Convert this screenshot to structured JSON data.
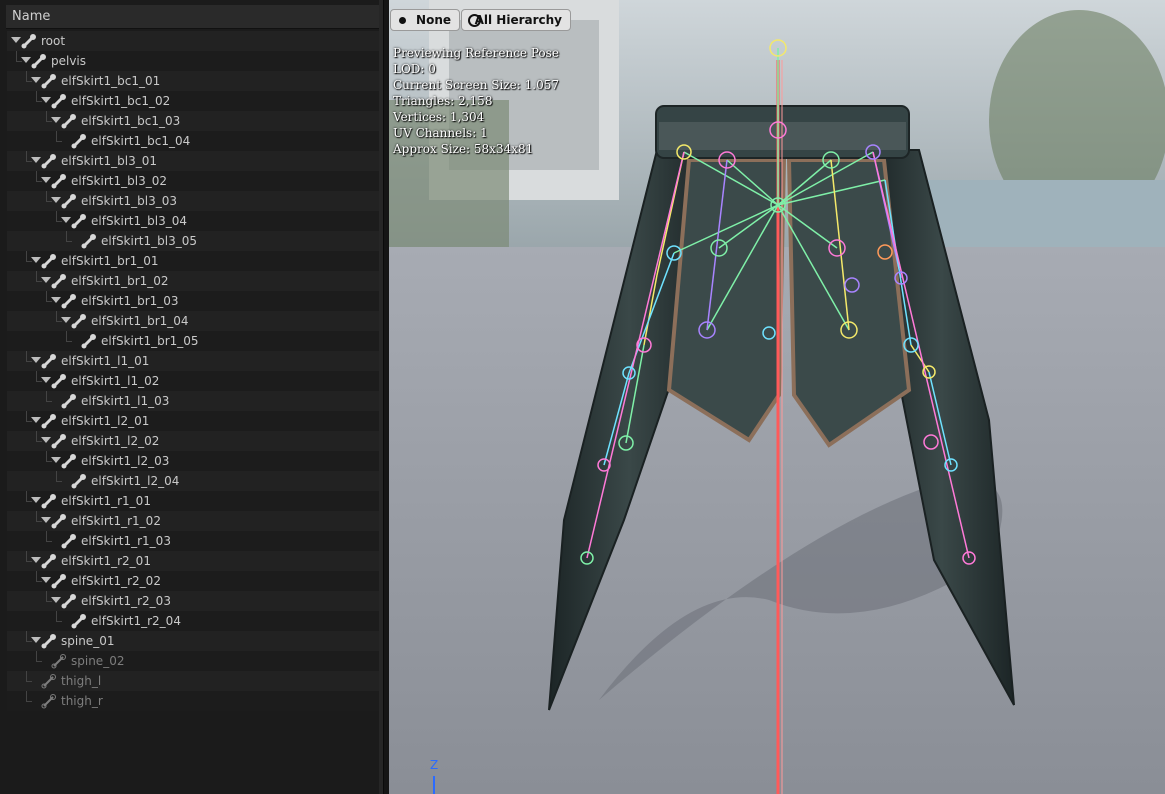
{
  "tree": {
    "column_header": "Name",
    "rows": [
      {
        "label": "root",
        "depth": 0,
        "expanded": true,
        "dim": false
      },
      {
        "label": "pelvis",
        "depth": 1,
        "expanded": true,
        "dim": false
      },
      {
        "label": "elfSkirt1_bc1_01",
        "depth": 2,
        "expanded": true,
        "dim": false
      },
      {
        "label": "elfSkirt1_bc1_02",
        "depth": 3,
        "expanded": true,
        "dim": false
      },
      {
        "label": "elfSkirt1_bc1_03",
        "depth": 4,
        "expanded": true,
        "dim": false
      },
      {
        "label": "elfSkirt1_bc1_04",
        "depth": 5,
        "expanded": false,
        "dim": false
      },
      {
        "label": "elfSkirt1_bl3_01",
        "depth": 2,
        "expanded": true,
        "dim": false
      },
      {
        "label": "elfSkirt1_bl3_02",
        "depth": 3,
        "expanded": true,
        "dim": false
      },
      {
        "label": "elfSkirt1_bl3_03",
        "depth": 4,
        "expanded": true,
        "dim": false
      },
      {
        "label": "elfSkirt1_bl3_04",
        "depth": 5,
        "expanded": true,
        "dim": false
      },
      {
        "label": "elfSkirt1_bl3_05",
        "depth": 6,
        "expanded": false,
        "dim": false
      },
      {
        "label": "elfSkirt1_br1_01",
        "depth": 2,
        "expanded": true,
        "dim": false
      },
      {
        "label": "elfSkirt1_br1_02",
        "depth": 3,
        "expanded": true,
        "dim": false
      },
      {
        "label": "elfSkirt1_br1_03",
        "depth": 4,
        "expanded": true,
        "dim": false
      },
      {
        "label": "elfSkirt1_br1_04",
        "depth": 5,
        "expanded": true,
        "dim": false
      },
      {
        "label": "elfSkirt1_br1_05",
        "depth": 6,
        "expanded": false,
        "dim": false
      },
      {
        "label": "elfSkirt1_l1_01",
        "depth": 2,
        "expanded": true,
        "dim": false
      },
      {
        "label": "elfSkirt1_l1_02",
        "depth": 3,
        "expanded": true,
        "dim": false
      },
      {
        "label": "elfSkirt1_l1_03",
        "depth": 4,
        "expanded": false,
        "dim": false
      },
      {
        "label": "elfSkirt1_l2_01",
        "depth": 2,
        "expanded": true,
        "dim": false
      },
      {
        "label": "elfSkirt1_l2_02",
        "depth": 3,
        "expanded": true,
        "dim": false
      },
      {
        "label": "elfSkirt1_l2_03",
        "depth": 4,
        "expanded": true,
        "dim": false
      },
      {
        "label": "elfSkirt1_l2_04",
        "depth": 5,
        "expanded": false,
        "dim": false
      },
      {
        "label": "elfSkirt1_r1_01",
        "depth": 2,
        "expanded": true,
        "dim": false
      },
      {
        "label": "elfSkirt1_r1_02",
        "depth": 3,
        "expanded": true,
        "dim": false
      },
      {
        "label": "elfSkirt1_r1_03",
        "depth": 4,
        "expanded": false,
        "dim": false
      },
      {
        "label": "elfSkirt1_r2_01",
        "depth": 2,
        "expanded": true,
        "dim": false
      },
      {
        "label": "elfSkirt1_r2_02",
        "depth": 3,
        "expanded": true,
        "dim": false
      },
      {
        "label": "elfSkirt1_r2_03",
        "depth": 4,
        "expanded": true,
        "dim": false
      },
      {
        "label": "elfSkirt1_r2_04",
        "depth": 5,
        "expanded": false,
        "dim": false
      },
      {
        "label": "spine_01",
        "depth": 2,
        "expanded": true,
        "dim": false
      },
      {
        "label": "spine_02",
        "depth": 3,
        "expanded": false,
        "dim": true
      },
      {
        "label": "thigh_l",
        "depth": 2,
        "expanded": false,
        "dim": true
      },
      {
        "label": "thigh_r",
        "depth": 2,
        "expanded": false,
        "dim": true
      }
    ]
  },
  "viewport": {
    "toolbar": {
      "none_label": "None",
      "hierarchy_label": "All Hierarchy"
    },
    "info": {
      "line1": "Previewing Reference Pose",
      "line2": "LOD: 0",
      "line3": "Current Screen Size: 1.057",
      "line4": "Triangles: 2,158",
      "line5": "Vertices: 1,304",
      "line6": "UV Channels: 1",
      "line7": "Approx Size: 58x34x81"
    },
    "axis_label": "Z",
    "colors": {
      "floor": "#8f939b",
      "skirt": "#2e3a3b",
      "bone_green": "#7ff0a8",
      "bone_pink": "#ff7ad8",
      "bone_yellow": "#f4e96a",
      "bone_cyan": "#6fe2ff",
      "bone_purple": "#a884ff",
      "root_line": "#ff5a5a"
    }
  }
}
